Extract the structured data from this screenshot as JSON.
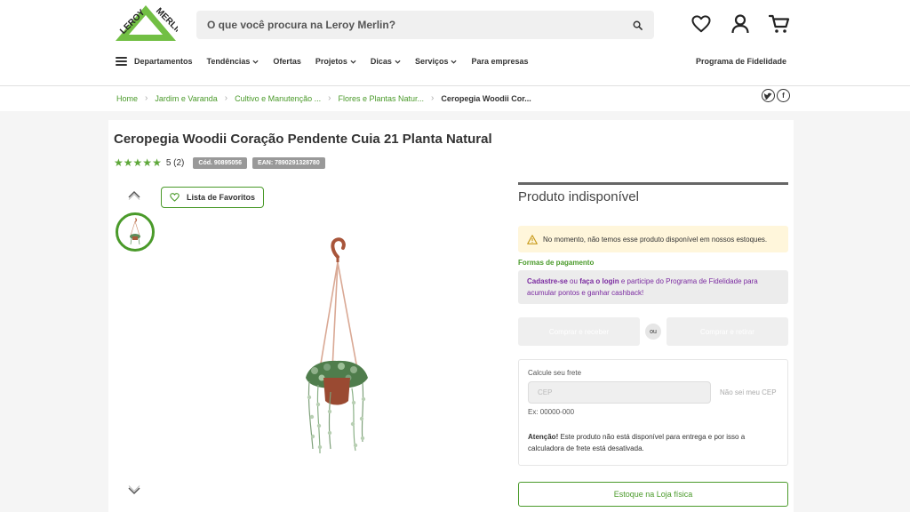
{
  "header": {
    "brand": "LEROY MERLIN",
    "search_placeholder": "O que você procura na Leroy Merlin?",
    "icons": [
      "heart-icon",
      "user-icon",
      "cart-icon"
    ],
    "colors": {
      "brand_green": "#72bf44",
      "link_green": "#4a9a2a",
      "loyalty_purple": "#7a2aa0",
      "notice_yellow": "#fff6db"
    }
  },
  "nav": {
    "departments": "Departamentos",
    "items": [
      {
        "label": "Tendências",
        "has_dropdown": true
      },
      {
        "label": "Ofertas",
        "has_dropdown": false
      },
      {
        "label": "Projetos",
        "has_dropdown": true
      },
      {
        "label": "Dicas",
        "has_dropdown": true
      },
      {
        "label": "Serviços",
        "has_dropdown": true
      },
      {
        "label": "Para empresas",
        "has_dropdown": false
      }
    ],
    "loyalty": "Programa de Fidelidade"
  },
  "breadcrumb": {
    "items": [
      "Home",
      "Jardim e Varanda",
      "Cultivo e Manutenção ...",
      "Flores e Plantas Natur..."
    ],
    "current": "Ceropegia Woodii Cor..."
  },
  "social": {
    "twitter": "t",
    "facebook": "f"
  },
  "product": {
    "title": "Ceropegia Woodii Coração Pendente Cuia 21 Planta Natural",
    "rating_value": 5,
    "rating_text": "5 (2)",
    "code": "Cód. 90895056",
    "ean": "EAN: 7890291328780",
    "favorites_label": "Lista de Favoritos"
  },
  "purchase": {
    "status": "Produto indisponível",
    "notice": "No momento, não temos esse produto disponível em nossos estoques.",
    "payment_title": "Formas de pagamento",
    "loyalty_signup": "Cadastre-se",
    "loyalty_or": "ou",
    "loyalty_login": "faça o login",
    "loyalty_rest": "e participe do Programa de Fidelidade para acumular pontos e ganhar cashback!",
    "buy_receive": "Comprar e receber",
    "buy_or": "ou",
    "buy_pickup": "Comprar e retirar",
    "freight_label": "Calcule seu frete",
    "cep_placeholder": "CEP",
    "no_cep": "Não sei meu CEP",
    "cep_example": "Ex: 00000-000",
    "attention_label": "Atenção!",
    "attention_text": "Este produto não está disponível para entrega e por isso a calculadora de frete está desativada.",
    "store_stock": "Estoque na Loja física"
  }
}
